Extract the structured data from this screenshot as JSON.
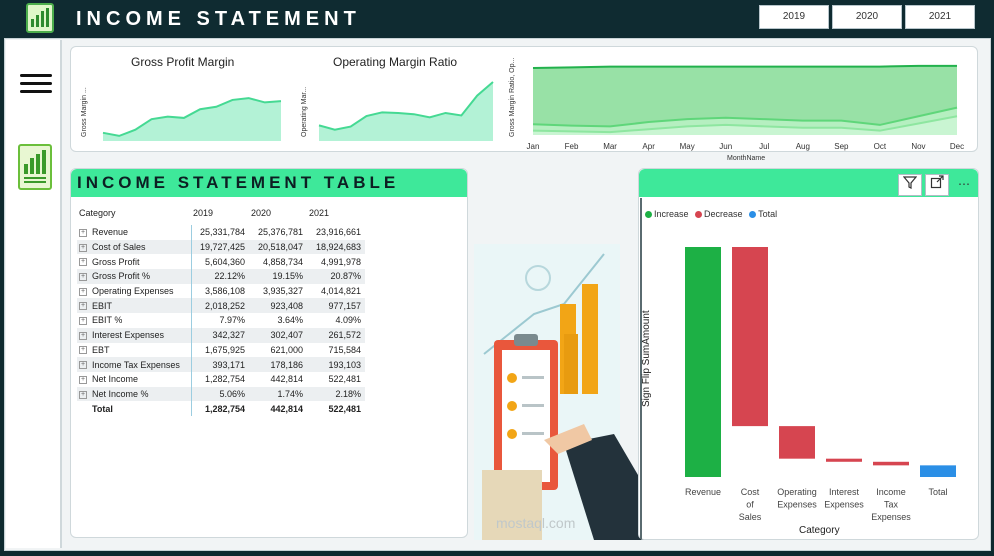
{
  "header": {
    "title": "INCOME STATEMENT",
    "years": [
      "2019",
      "2020",
      "2021"
    ]
  },
  "colors": {
    "header_bg": "#0f2b31",
    "accent_green": "#3ee89a",
    "increase": "#1db045",
    "decrease": "#d64550",
    "total": "#2b8fe6"
  },
  "icons": {
    "menu": "hamburger-icon",
    "report": "chart-report-icon",
    "filter": "filter-icon",
    "focus": "focus-mode-icon",
    "more": "more-options-icon"
  },
  "gross_profit_chart": {
    "title": "Gross Profit Margin",
    "ylabel": "Gross Margin ...",
    "chart_data": {
      "type": "area",
      "title": "Gross Profit Margin",
      "ylabel": "Gross Margin ...",
      "values": [
        0.1,
        0.05,
        0.15,
        0.32,
        0.36,
        0.34,
        0.48,
        0.52,
        0.63,
        0.66,
        0.59,
        0.61
      ]
    }
  },
  "operating_margin_chart": {
    "title": "Operating Margin Ratio",
    "ylabel": "Operating Mar...",
    "chart_data": {
      "type": "area",
      "title": "Operating Margin Ratio",
      "ylabel": "Operating Mar...",
      "values": [
        0.22,
        0.15,
        0.2,
        0.37,
        0.43,
        0.42,
        0.4,
        0.35,
        0.42,
        0.38,
        0.7,
        0.92
      ]
    }
  },
  "monthly_chart": {
    "ylabel": "Gross Margin Ratio, Op...",
    "xlabel": "MonthName",
    "chart_data": {
      "type": "area",
      "x": [
        "Jan",
        "Feb",
        "Mar",
        "Apr",
        "May",
        "Jun",
        "Jul",
        "Aug",
        "Sep",
        "Oct",
        "Nov",
        "Dec"
      ],
      "xlabel": "MonthName",
      "ylabel": "Gross Margin Ratio, Op...",
      "series": [
        {
          "values": [
            0.93,
            0.94,
            0.95,
            0.95,
            0.95,
            0.95,
            0.95,
            0.95,
            0.95,
            0.95,
            0.96,
            0.96
          ]
        },
        {
          "values": [
            0.15,
            0.13,
            0.12,
            0.18,
            0.22,
            0.24,
            0.22,
            0.2,
            0.2,
            0.14,
            0.26,
            0.38
          ]
        },
        {
          "values": [
            0.06,
            0.05,
            0.04,
            0.08,
            0.12,
            0.14,
            0.12,
            0.1,
            0.1,
            0.06,
            0.16,
            0.26
          ]
        }
      ]
    }
  },
  "table": {
    "title": "INCOME STATEMENT TABLE",
    "columns": [
      "Category",
      "2019",
      "2020",
      "2021"
    ],
    "rows": [
      {
        "label": "Revenue",
        "v2019": "25,331,784",
        "v2020": "25,376,781",
        "v2021": "23,916,661"
      },
      {
        "label": "Cost of Sales",
        "v2019": "19,727,425",
        "v2020": "20,518,047",
        "v2021": "18,924,683"
      },
      {
        "label": "Gross Profit",
        "v2019": "5,604,360",
        "v2020": "4,858,734",
        "v2021": "4,991,978"
      },
      {
        "label": "Gross Profit %",
        "v2019": "22.12%",
        "v2020": "19.15%",
        "v2021": "20.87%"
      },
      {
        "label": "Operating Expenses",
        "v2019": "3,586,108",
        "v2020": "3,935,327",
        "v2021": "4,014,821"
      },
      {
        "label": "EBIT",
        "v2019": "2,018,252",
        "v2020": "923,408",
        "v2021": "977,157"
      },
      {
        "label": "EBIT %",
        "v2019": "7.97%",
        "v2020": "3.64%",
        "v2021": "4.09%"
      },
      {
        "label": "Interest Expenses",
        "v2019": "342,327",
        "v2020": "302,407",
        "v2021": "261,572"
      },
      {
        "label": "EBT",
        "v2019": "1,675,925",
        "v2020": "621,000",
        "v2021": "715,584"
      },
      {
        "label": "Income Tax Expenses",
        "v2019": "393,171",
        "v2020": "178,186",
        "v2021": "193,103"
      },
      {
        "label": "Net Income",
        "v2019": "1,282,754",
        "v2020": "442,814",
        "v2021": "522,481"
      },
      {
        "label": "Net Income %",
        "v2019": "5.06%",
        "v2020": "1.74%",
        "v2021": "2.18%"
      }
    ],
    "total": {
      "label": "Total",
      "v2019": "1,282,754",
      "v2020": "442,814",
      "v2021": "522,481"
    }
  },
  "waterfall": {
    "legend": [
      "Increase",
      "Decrease",
      "Total"
    ],
    "ylabel": "Sign Flip SumAmount",
    "xlabel": "Category",
    "chart_data": {
      "type": "bar",
      "title": "",
      "xlabel": "Category",
      "ylabel": "Sign Flip SumAmount",
      "categories": [
        "Revenue",
        "Cost of Sales",
        "Operating Expenses",
        "Interest Expenses",
        "Income Tax Expenses",
        "Total"
      ],
      "values": [
        25331784,
        -19727425,
        -3586108,
        -342327,
        -393171,
        1282754
      ],
      "kinds": [
        "increase",
        "decrease",
        "decrease",
        "decrease",
        "decrease",
        "total"
      ],
      "ylim": [
        0,
        25331784
      ]
    }
  },
  "watermark": "mostaql.com"
}
